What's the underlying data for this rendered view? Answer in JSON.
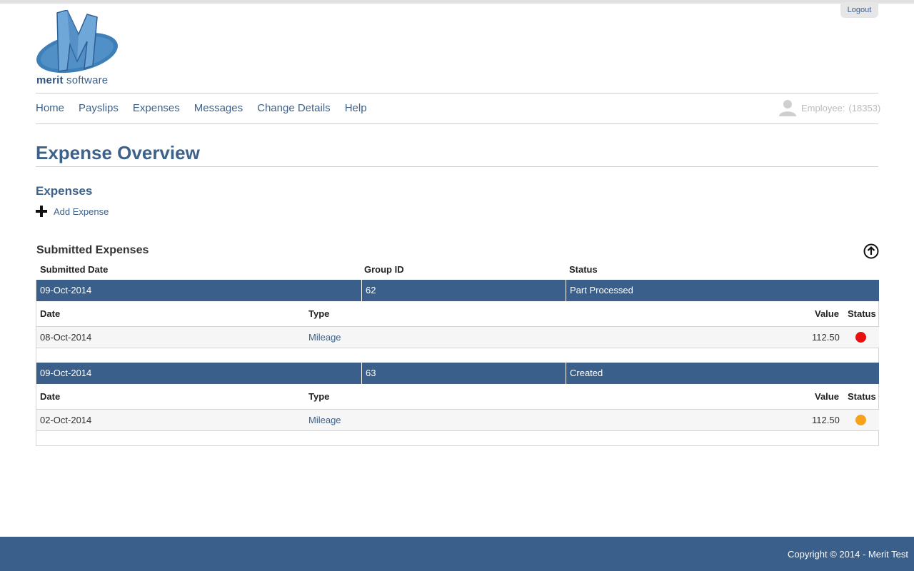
{
  "header": {
    "logout_label": "Logout",
    "logo_text_bold": "merit",
    "logo_text_rest": " software"
  },
  "nav": {
    "items": [
      "Home",
      "Payslips",
      "Expenses",
      "Messages",
      "Change Details",
      "Help"
    ],
    "employee_label": "Employee:",
    "employee_id": "(18353)"
  },
  "page": {
    "title": "Expense Overview",
    "section_title": "Expenses",
    "add_expense_label": "Add Expense",
    "submitted_title": "Submitted Expenses"
  },
  "table": {
    "columns": [
      "Submitted Date",
      "Group ID",
      "Status"
    ],
    "detail_columns": [
      "Date",
      "Type",
      "Value",
      "Status"
    ],
    "groups": [
      {
        "submitted_date": "09-Oct-2014",
        "group_id": "62",
        "status": "Part Processed",
        "items": [
          {
            "date": "08-Oct-2014",
            "type": "Mileage",
            "value": "112.50",
            "status_color": "#e8110f"
          }
        ]
      },
      {
        "submitted_date": "09-Oct-2014",
        "group_id": "63",
        "status": "Created",
        "items": [
          {
            "date": "02-Oct-2014",
            "type": "Mileage",
            "value": "112.50",
            "status_color": "#f7a21a"
          }
        ]
      }
    ]
  },
  "footer": {
    "copyright": "Copyright © 2014 - Merit Test"
  },
  "colors": {
    "brand": "#3a5f8a",
    "link": "#3d6189"
  }
}
